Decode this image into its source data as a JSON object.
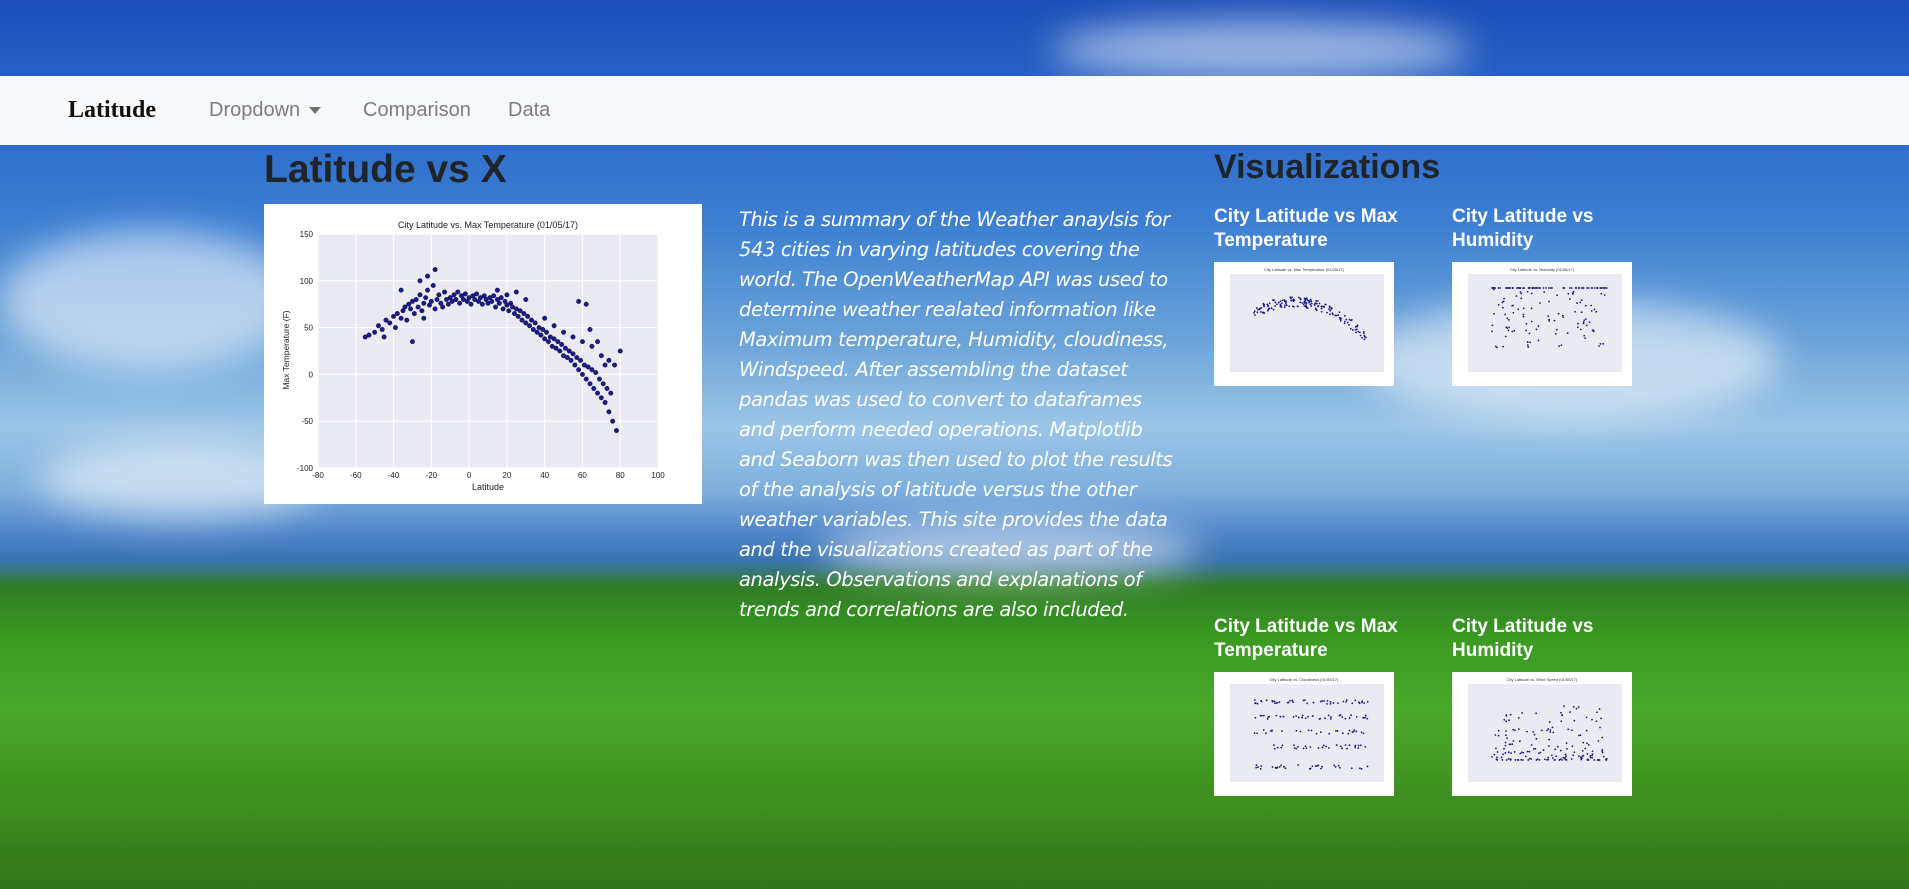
{
  "navbar": {
    "brand": "Latitude",
    "items": [
      {
        "label": "Dropdown",
        "has_caret": true
      },
      {
        "label": "Comparison"
      },
      {
        "label": "Data"
      }
    ]
  },
  "main": {
    "heading": "Latitude vs X",
    "summary": "This is a summary of the Weather anaylsis for 543 cities in varying latitudes covering the world. The OpenWeatherMap API was used to determine weather realated information like Maximum temperature, Humidity, cloudiness, Windspeed. After assembling the dataset pandas was used to convert to dataframes and perform needed operations. Matplotlib and Seaborn was then used to plot the results of the analysis of latitude versus the other weather variables. This site provides the data and the visualizations created as part of the analysis. Observations and explanations of trends and correlations are also included."
  },
  "visualizations": {
    "heading": "Visualizations",
    "cards": [
      {
        "title": "City Latitude vs Max Temperature",
        "plot_title": "City Latitude vs. Max Temperature (01/05/17)"
      },
      {
        "title": "City Latitude vs Humidity",
        "plot_title": "City Latitude vs. Humidity (01/05/17)"
      },
      {
        "title": "City Latitude vs Max Temperature",
        "plot_title": "City Latitude vs. Cloudiness (01/05/17)"
      },
      {
        "title": "City Latitude vs Humidity",
        "plot_title": "City Latitude vs. Wind Speed (01/05/17)"
      }
    ]
  },
  "chart_data": {
    "type": "scatter",
    "title": "City Latitude vs. Max Temperature (01/05/17)",
    "xlabel": "Latitude",
    "ylabel": "Max Temperature (F)",
    "xlim": [
      -80,
      100
    ],
    "ylim": [
      -100,
      150
    ],
    "xticks": [
      -80,
      -60,
      -40,
      -20,
      0,
      20,
      40,
      60,
      80,
      100
    ],
    "yticks": [
      150,
      100,
      50,
      0,
      -50,
      -100
    ],
    "grid": true,
    "point_color": "#1a1a8c",
    "points": [
      [
        -55,
        40
      ],
      [
        -53,
        42
      ],
      [
        -50,
        45
      ],
      [
        -48,
        52
      ],
      [
        -46,
        48
      ],
      [
        -45,
        40
      ],
      [
        -44,
        58
      ],
      [
        -42,
        55
      ],
      [
        -40,
        62
      ],
      [
        -39,
        50
      ],
      [
        -38,
        65
      ],
      [
        -36,
        60
      ],
      [
        -35,
        68
      ],
      [
        -34,
        72
      ],
      [
        -33,
        58
      ],
      [
        -32,
        75
      ],
      [
        -31,
        70
      ],
      [
        -30,
        78
      ],
      [
        -29,
        65
      ],
      [
        -28,
        80
      ],
      [
        -27,
        72
      ],
      [
        -26,
        85
      ],
      [
        -25,
        68
      ],
      [
        -24,
        76
      ],
      [
        -23,
        82
      ],
      [
        -22,
        90
      ],
      [
        -21,
        74
      ],
      [
        -20,
        78
      ],
      [
        -19,
        95
      ],
      [
        -18,
        70
      ],
      [
        -17,
        80
      ],
      [
        -16,
        85
      ],
      [
        -15,
        76
      ],
      [
        -14,
        72
      ],
      [
        -13,
        88
      ],
      [
        -12,
        80
      ],
      [
        -11,
        75
      ],
      [
        -10,
        82
      ],
      [
        -9,
        78
      ],
      [
        -8,
        85
      ],
      [
        -7,
        80
      ],
      [
        -6,
        88
      ],
      [
        -5,
        76
      ],
      [
        -4,
        84
      ],
      [
        -3,
        80
      ],
      [
        -2,
        86
      ],
      [
        -1,
        78
      ],
      [
        0,
        82
      ],
      [
        1,
        75
      ],
      [
        2,
        84
      ],
      [
        3,
        80
      ],
      [
        4,
        86
      ],
      [
        5,
        78
      ],
      [
        6,
        82
      ],
      [
        7,
        75
      ],
      [
        8,
        84
      ],
      [
        9,
        80
      ],
      [
        10,
        76
      ],
      [
        11,
        82
      ],
      [
        12,
        78
      ],
      [
        13,
        84
      ],
      [
        14,
        72
      ],
      [
        15,
        80
      ],
      [
        16,
        76
      ],
      [
        17,
        82
      ],
      [
        18,
        70
      ],
      [
        19,
        78
      ],
      [
        20,
        74
      ],
      [
        21,
        68
      ],
      [
        22,
        76
      ],
      [
        23,
        72
      ],
      [
        24,
        65
      ],
      [
        25,
        70
      ],
      [
        26,
        62
      ],
      [
        27,
        68
      ],
      [
        28,
        58
      ],
      [
        29,
        65
      ],
      [
        30,
        55
      ],
      [
        31,
        62
      ],
      [
        32,
        52
      ],
      [
        33,
        58
      ],
      [
        34,
        48
      ],
      [
        35,
        55
      ],
      [
        36,
        45
      ],
      [
        37,
        50
      ],
      [
        38,
        42
      ],
      [
        39,
        48
      ],
      [
        40,
        38
      ],
      [
        41,
        45
      ],
      [
        42,
        35
      ],
      [
        43,
        40
      ],
      [
        44,
        30
      ],
      [
        45,
        38
      ],
      [
        46,
        28
      ],
      [
        47,
        35
      ],
      [
        48,
        25
      ],
      [
        49,
        32
      ],
      [
        50,
        20
      ],
      [
        51,
        28
      ],
      [
        52,
        18
      ],
      [
        53,
        25
      ],
      [
        54,
        15
      ],
      [
        55,
        22
      ],
      [
        56,
        10
      ],
      [
        57,
        18
      ],
      [
        58,
        5
      ],
      [
        59,
        15
      ],
      [
        60,
        0
      ],
      [
        61,
        10
      ],
      [
        62,
        -5
      ],
      [
        63,
        8
      ],
      [
        64,
        -10
      ],
      [
        65,
        5
      ],
      [
        66,
        -15
      ],
      [
        67,
        2
      ],
      [
        68,
        -20
      ],
      [
        69,
        -5
      ],
      [
        70,
        -25
      ],
      [
        71,
        -10
      ],
      [
        72,
        -30
      ],
      [
        73,
        -15
      ],
      [
        74,
        -40
      ],
      [
        75,
        -20
      ],
      [
        76,
        -50
      ],
      [
        77,
        10
      ],
      [
        78,
        -60
      ],
      [
        80,
        25
      ],
      [
        62,
        75
      ],
      [
        58,
        78
      ],
      [
        64,
        48
      ],
      [
        -30,
        35
      ],
      [
        -24,
        60
      ],
      [
        -22,
        105
      ],
      [
        -26,
        100
      ],
      [
        -18,
        112
      ],
      [
        -36,
        90
      ],
      [
        20,
        85
      ],
      [
        30,
        80
      ],
      [
        25,
        88
      ],
      [
        15,
        90
      ],
      [
        40,
        60
      ],
      [
        45,
        52
      ],
      [
        50,
        45
      ],
      [
        55,
        40
      ],
      [
        60,
        35
      ],
      [
        65,
        30
      ],
      [
        70,
        20
      ],
      [
        72,
        10
      ],
      [
        68,
        35
      ],
      [
        74,
        15
      ]
    ]
  }
}
